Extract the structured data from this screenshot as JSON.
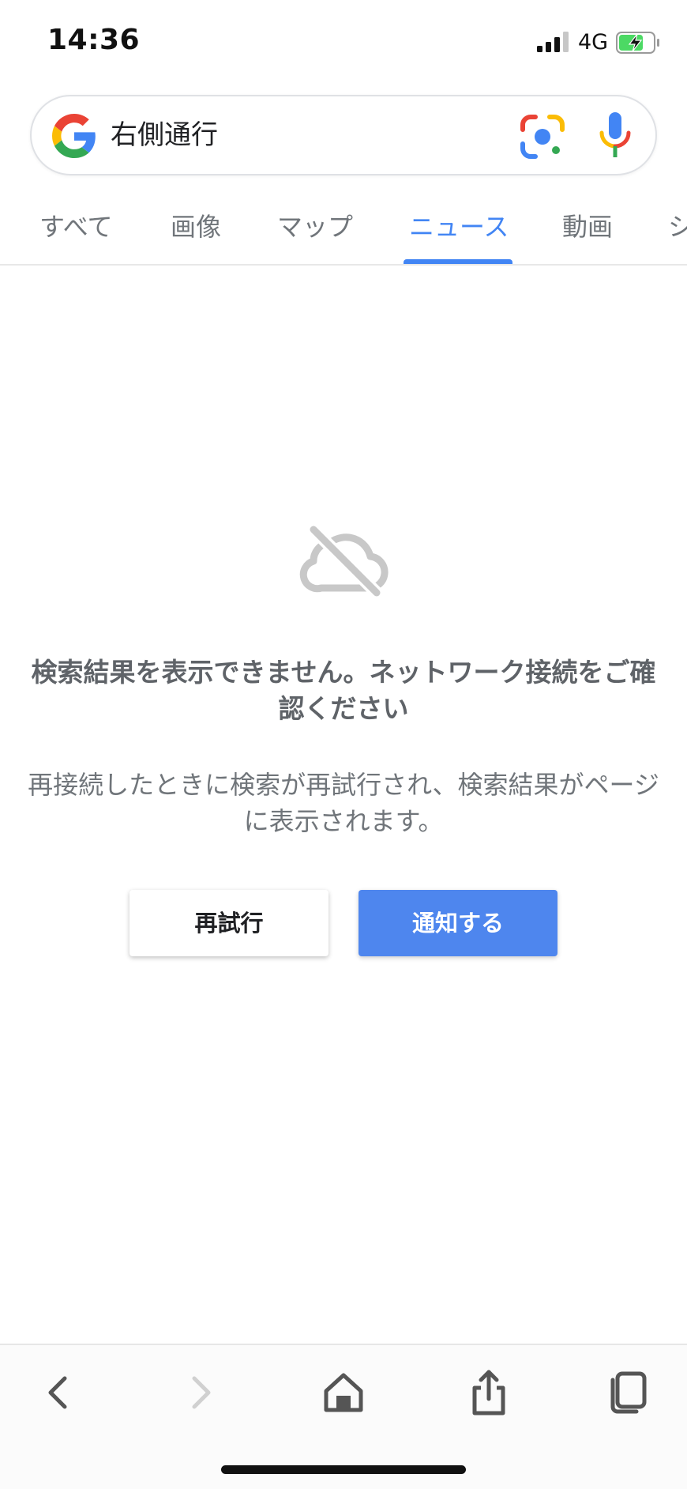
{
  "status": {
    "time": "14:36",
    "network": "4G"
  },
  "search": {
    "query": "右側通行"
  },
  "tabs": [
    {
      "label": "すべて"
    },
    {
      "label": "画像"
    },
    {
      "label": "マップ"
    },
    {
      "label": "ニュース"
    },
    {
      "label": "動画"
    },
    {
      "label": "シ"
    }
  ],
  "active_tab": "ニュース",
  "error": {
    "title": "検索結果を表示できません。ネットワーク接続をご確認ください",
    "description": "再接続したときに検索が再試行され、検索結果がページに表示されます。",
    "retry_label": "再試行",
    "notify_label": "通知する"
  },
  "icons": {
    "back": "chevron-left-icon",
    "forward": "chevron-right-icon",
    "home": "home-icon",
    "share": "share-icon",
    "tabs": "tabs-icon"
  },
  "colors": {
    "accent": "#4285f4",
    "notify_button": "#4e86ee"
  }
}
